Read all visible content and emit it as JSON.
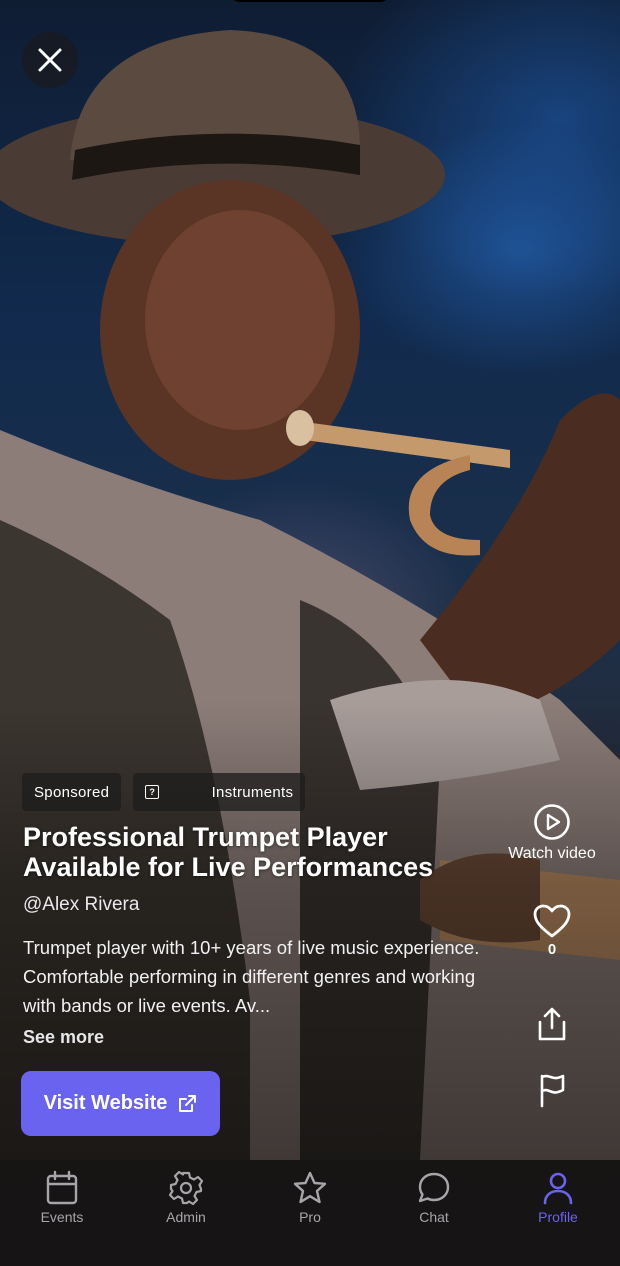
{
  "close": {
    "icon": "close-icon"
  },
  "tags": {
    "sponsored": "Sponsored",
    "category_icon": "?",
    "category": "Instruments"
  },
  "post": {
    "title": "Professional Trumpet Player Available for Live Performances",
    "author": "@Alex Rivera",
    "description": "Trumpet player with 10+ years of live music experience. Comfortable performing in different genres and working with bands or live events. Av...",
    "see_more": "See more",
    "cta": "Visit Website"
  },
  "actions": {
    "watch_video": "Watch video",
    "like_count": "0"
  },
  "nav": {
    "items": [
      {
        "label": "Events",
        "icon": "calendar-icon"
      },
      {
        "label": "Admin",
        "icon": "gear-icon"
      },
      {
        "label": "Pro",
        "icon": "star-icon"
      },
      {
        "label": "Chat",
        "icon": "chat-bubble-icon"
      },
      {
        "label": "Profile",
        "icon": "person-icon"
      }
    ],
    "active": "Profile",
    "active_color": "#6a63ef"
  },
  "colors": {
    "accent": "#6a63ef"
  }
}
